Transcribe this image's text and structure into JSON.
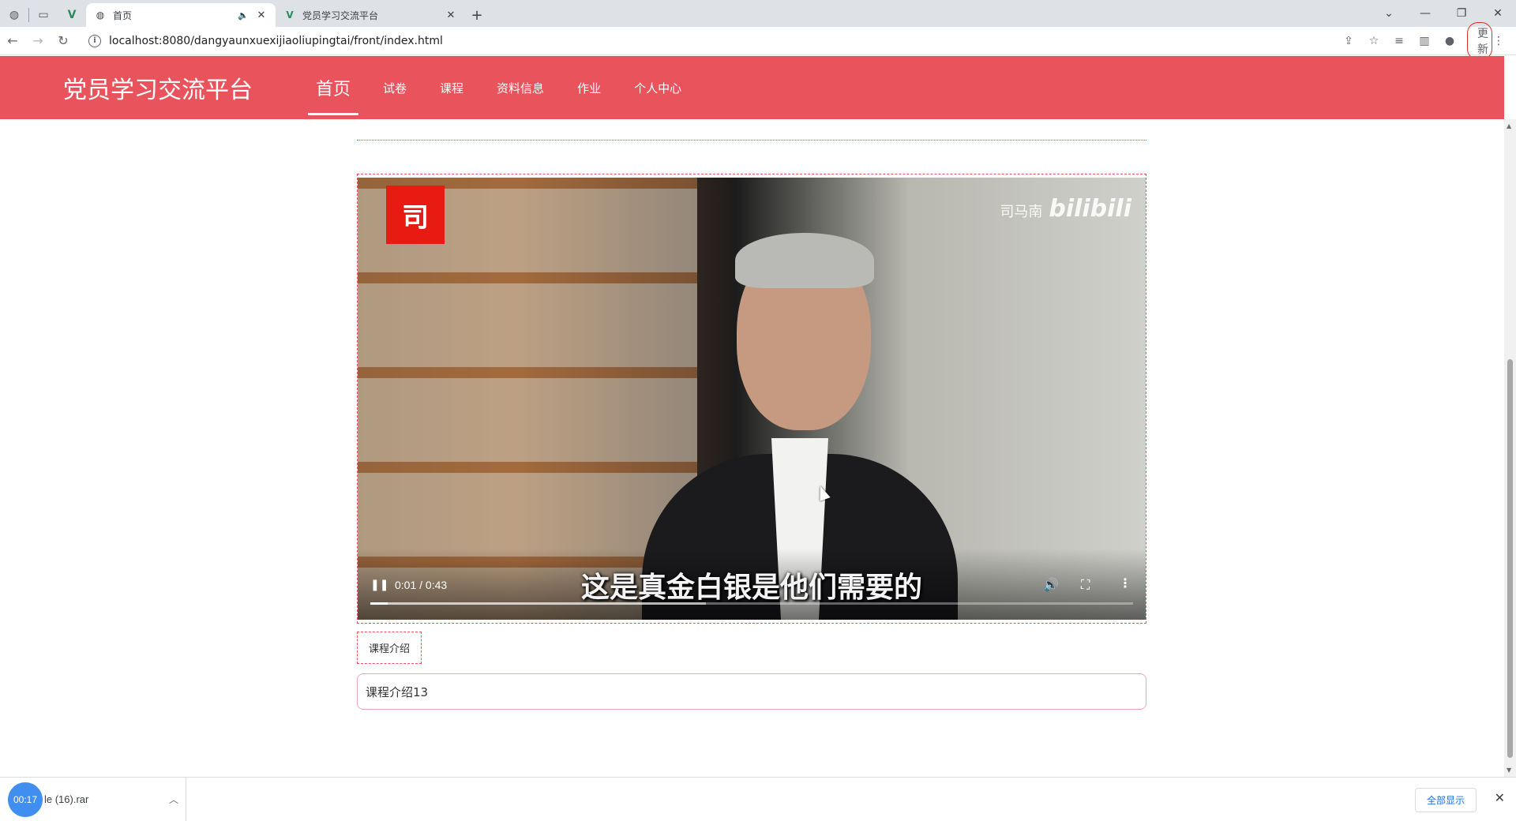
{
  "browser": {
    "tabs": [
      {
        "title": "首页",
        "active": true,
        "muted": true
      },
      {
        "title": "党员学习交流平台",
        "active": false
      }
    ],
    "url": "localhost:8080/dangyaunxuexijiaoliupingtai/front/index.html",
    "update_label": "更新"
  },
  "site": {
    "logo": "党员学习交流平台",
    "nav": [
      {
        "label": "首页",
        "active": true
      },
      {
        "label": "试卷"
      },
      {
        "label": "课程"
      },
      {
        "label": "资料信息"
      },
      {
        "label": "作业"
      },
      {
        "label": "个人中心"
      }
    ]
  },
  "video": {
    "channel_badge": "司",
    "watermark_name": "司马南",
    "watermark_brand": "bilibili",
    "subtitle": "这是真金白银是他们需要的",
    "current_time": "0:01",
    "duration": "0:43",
    "time_display": "0:01 / 0:43",
    "progress_fraction": 0.023,
    "buffered_fraction": 0.44
  },
  "course": {
    "intro_tab_label": "课程介绍",
    "intro_text": "课程介绍13"
  },
  "downloads": {
    "timer": "00:17",
    "file_name": "le (16).rar",
    "show_all_label": "全部显示"
  },
  "colors": {
    "header_red": "#e9535c",
    "badge_red": "#e81b12",
    "download_timer_blue": "#3f8ef0"
  }
}
